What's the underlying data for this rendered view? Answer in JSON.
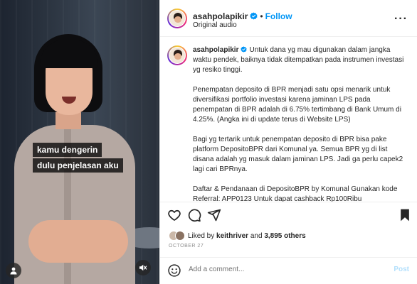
{
  "video": {
    "caption_lines": [
      "kamu dengerin",
      "dulu penjelasan aku"
    ]
  },
  "header": {
    "username": "asahpolapikir",
    "separator": "•",
    "follow_label": "Follow",
    "audio_label": "Original audio",
    "more_label": "···"
  },
  "post": {
    "username": "asahpolapikir",
    "paragraphs": [
      "Untuk dana yg mau digunakan dalam jangka waktu pendek, baiknya tidak ditempatkan pada instrumen investasi yg resiko tinggi.",
      "Penempatan deposito di BPR menjadi satu opsi menarik untuk diversifikasi portfolio investasi karena jaminan LPS pada penempatan di BPR adalah di 6.75% tertimbang di Bank Umum di 4.25%. (Angka ini di update terus di Website LPS)",
      "Bagi yg tertarik untuk penempatan deposito di BPR bisa pake platform DepositoBPR dari Komunal ya. Semua BPR yg di list disana adalah yg masuk dalam jaminan LPS. Jadi ga perlu capek2 lagi cari BPRnya.",
      "Daftar & Pendanaan di DepositoBPR by Komunal Gunakan kode Referral: APP0123 Untuk dapat cashback Rp100Ribu"
    ]
  },
  "engagement": {
    "liked_by_prefix": "Liked by",
    "liked_by_user": "keithriver",
    "and_label": "and",
    "others_label": "3,895 others",
    "date": "OCTOBER 27"
  },
  "comment_box": {
    "placeholder": "Add a comment...",
    "post_label": "Post"
  },
  "colors": {
    "accent_blue": "#0095f6",
    "post_disabled": "#b2dffc",
    "muted_text": "#737373"
  },
  "icons": [
    "user-tag-icon",
    "mute-icon",
    "verified-icon",
    "heart-icon",
    "comment-icon",
    "share-icon",
    "bookmark-icon",
    "emoji-icon"
  ]
}
